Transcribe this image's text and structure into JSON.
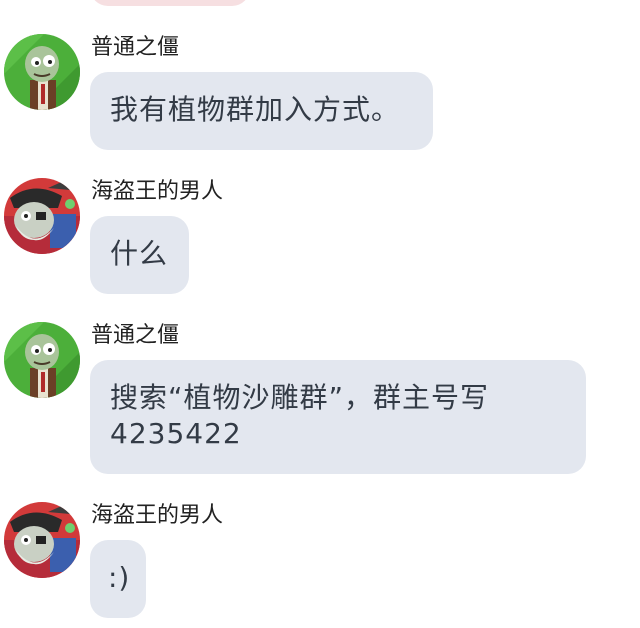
{
  "messages": [
    {
      "sender": "普通之僵",
      "avatar": "zombie-avatar-icon",
      "text": "我有植物群加入方式。"
    },
    {
      "sender": "海盗王的男人",
      "avatar": "pirate-zombie-avatar-icon",
      "text": "什么"
    },
    {
      "sender": "普通之僵",
      "avatar": "zombie-avatar-icon",
      "text": "搜索“植物沙雕群”，群主号写\n4235422"
    },
    {
      "sender": "海盗王的男人",
      "avatar": "pirate-zombie-avatar-icon",
      "text": ":)"
    }
  ],
  "colors": {
    "bubble_bg": "#e3e7ef",
    "bubble_text": "#333b46",
    "previous_bubble_bg": "#f6dfe1"
  }
}
